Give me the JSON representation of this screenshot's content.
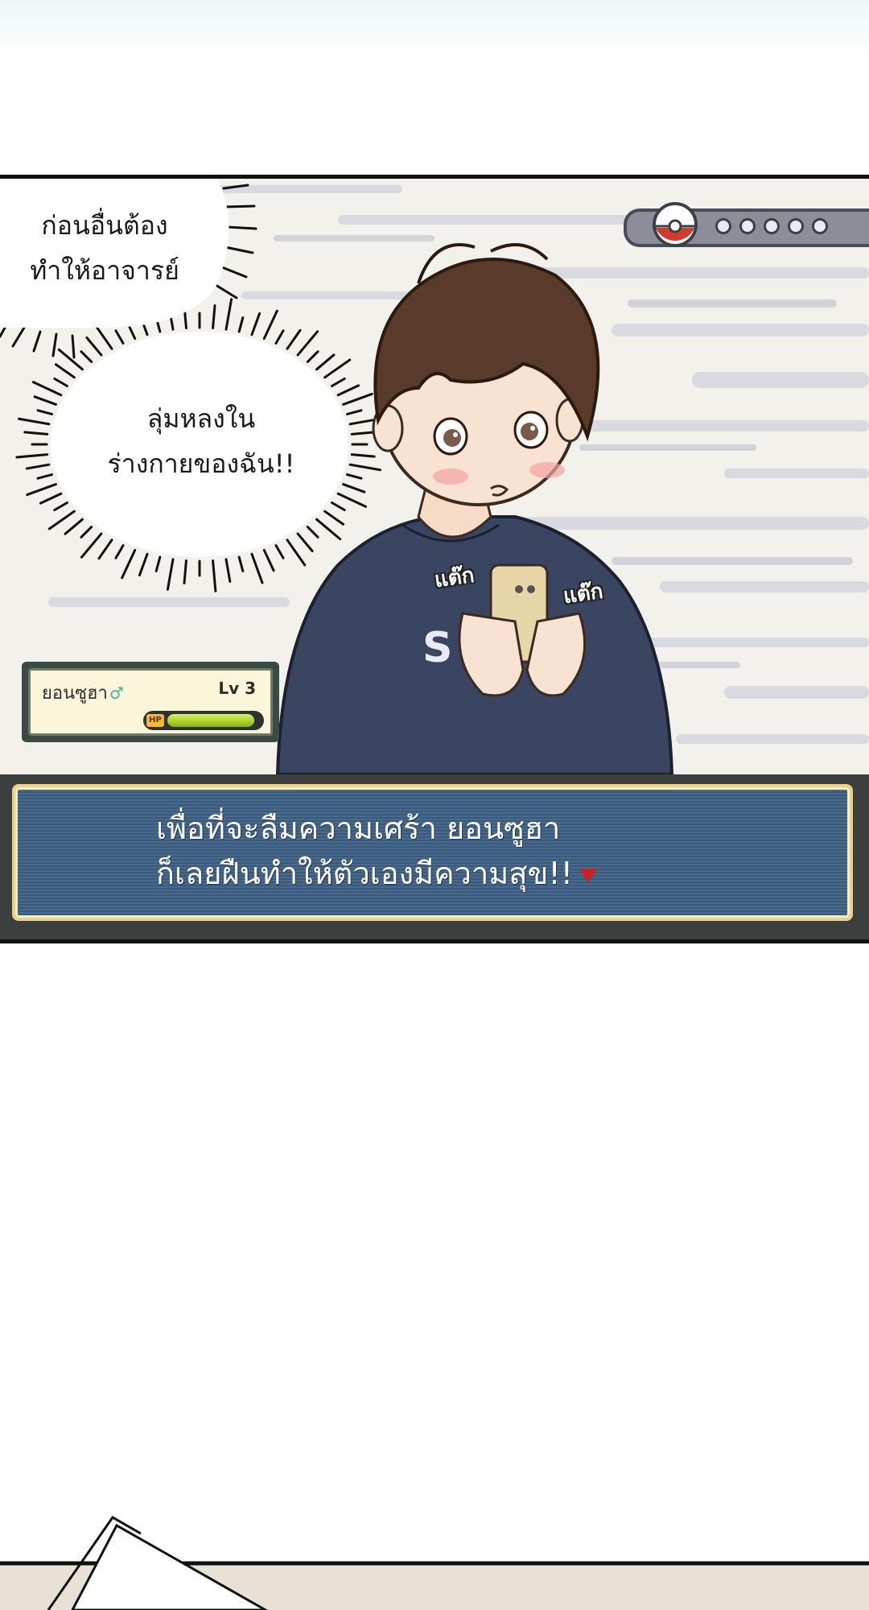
{
  "speech_bubbles": [
    {
      "lines": [
        "ก่อนอื่นต้อง",
        "ทำให้อาจารย์"
      ]
    },
    {
      "lines": [
        "ลุ่มหลงใน",
        "ร่างกายของฉัน!!"
      ]
    }
  ],
  "sound_effects": [
    "แต๊ก",
    "แต๊ก"
  ],
  "status": {
    "name": "ยอนซูฮา",
    "gender_icon": "♂",
    "level": "Lv 3",
    "hp_label": "HP",
    "hp_fraction": 0.95
  },
  "party_bar": {
    "icon": "pokeball-icon",
    "slots": 5
  },
  "dialog": {
    "lines": [
      "เพื่อที่จะลืมความเศร้า ยอนซูฮา",
      "ก็เลยฝืนทำให้ตัวเองมีความสุข!!"
    ]
  },
  "colors": {
    "dialog_bg": "#3c5f83",
    "dialog_frame": "#e9d18a",
    "hp_green": "#a9cf2a",
    "sweater": "#3a4562",
    "hair": "#5a3b2a",
    "arrow": "#d11f1f"
  }
}
